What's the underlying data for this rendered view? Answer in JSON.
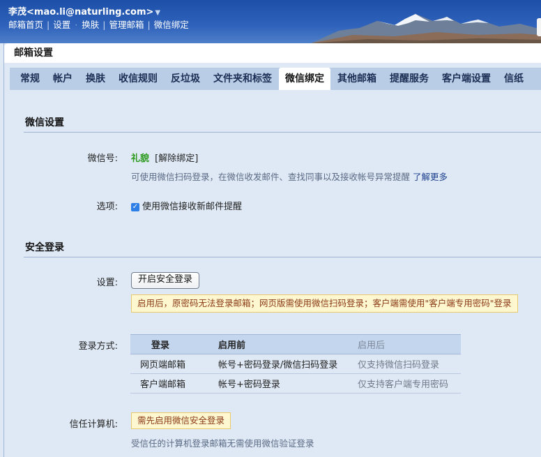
{
  "header": {
    "user_display": "李茂<mao.li@naturling.com>",
    "caret": "▼",
    "links": [
      "邮箱首页",
      "设置",
      "换肤",
      "管理邮箱",
      "微信绑定"
    ]
  },
  "panel": {
    "title": "邮箱设置",
    "tabs": [
      "常规",
      "帐户",
      "换肤",
      "收信规则",
      "反垃圾",
      "文件夹和标签",
      "微信绑定",
      "其他邮箱",
      "提醒服务",
      "客户端设置",
      "信纸"
    ],
    "active_tab": "微信绑定"
  },
  "wechat": {
    "section_title": "微信设置",
    "id_label": "微信号:",
    "id_value": "礼貌",
    "unbind_link": "[解除绑定]",
    "description": "可使用微信扫码登录，在微信收发邮件、查找同事以及接收帐号异常提醒",
    "learn_more": "了解更多",
    "options_label": "选项:",
    "option_checkbox": "使用微信接收新邮件提醒",
    "option_checked": true
  },
  "secure": {
    "section_title": "安全登录",
    "settings_label": "设置:",
    "enable_button": "开启安全登录",
    "notice": "启用后，原密码无法登录邮箱；网页版需使用微信扫码登录；客户端需使用\"客户端专用密码\"登录",
    "login_method_label": "登录方式:",
    "table": {
      "headers": [
        "登录",
        "启用前",
        "启用后"
      ],
      "rows": [
        [
          "网页端邮箱",
          "帐号+密码登录/微信扫码登录",
          "仅支持微信扫码登录"
        ],
        [
          "客户端邮箱",
          "帐号+密码登录",
          "仅支持客户端专用密码"
        ]
      ]
    },
    "trusted_label": "信任计算机:",
    "trusted_notice": "需先启用微信安全登录",
    "trusted_desc": "受信任的计算机登录邮箱无需使用微信验证登录"
  },
  "colors": {
    "banner": "#2f63bb",
    "tab_bar": "#b9cde6",
    "panel_bg": "#dfe9f5",
    "wechat_green": "#2c9a1e",
    "notice_bg": "#fff7cf",
    "notice_text": "#8a3a16"
  }
}
